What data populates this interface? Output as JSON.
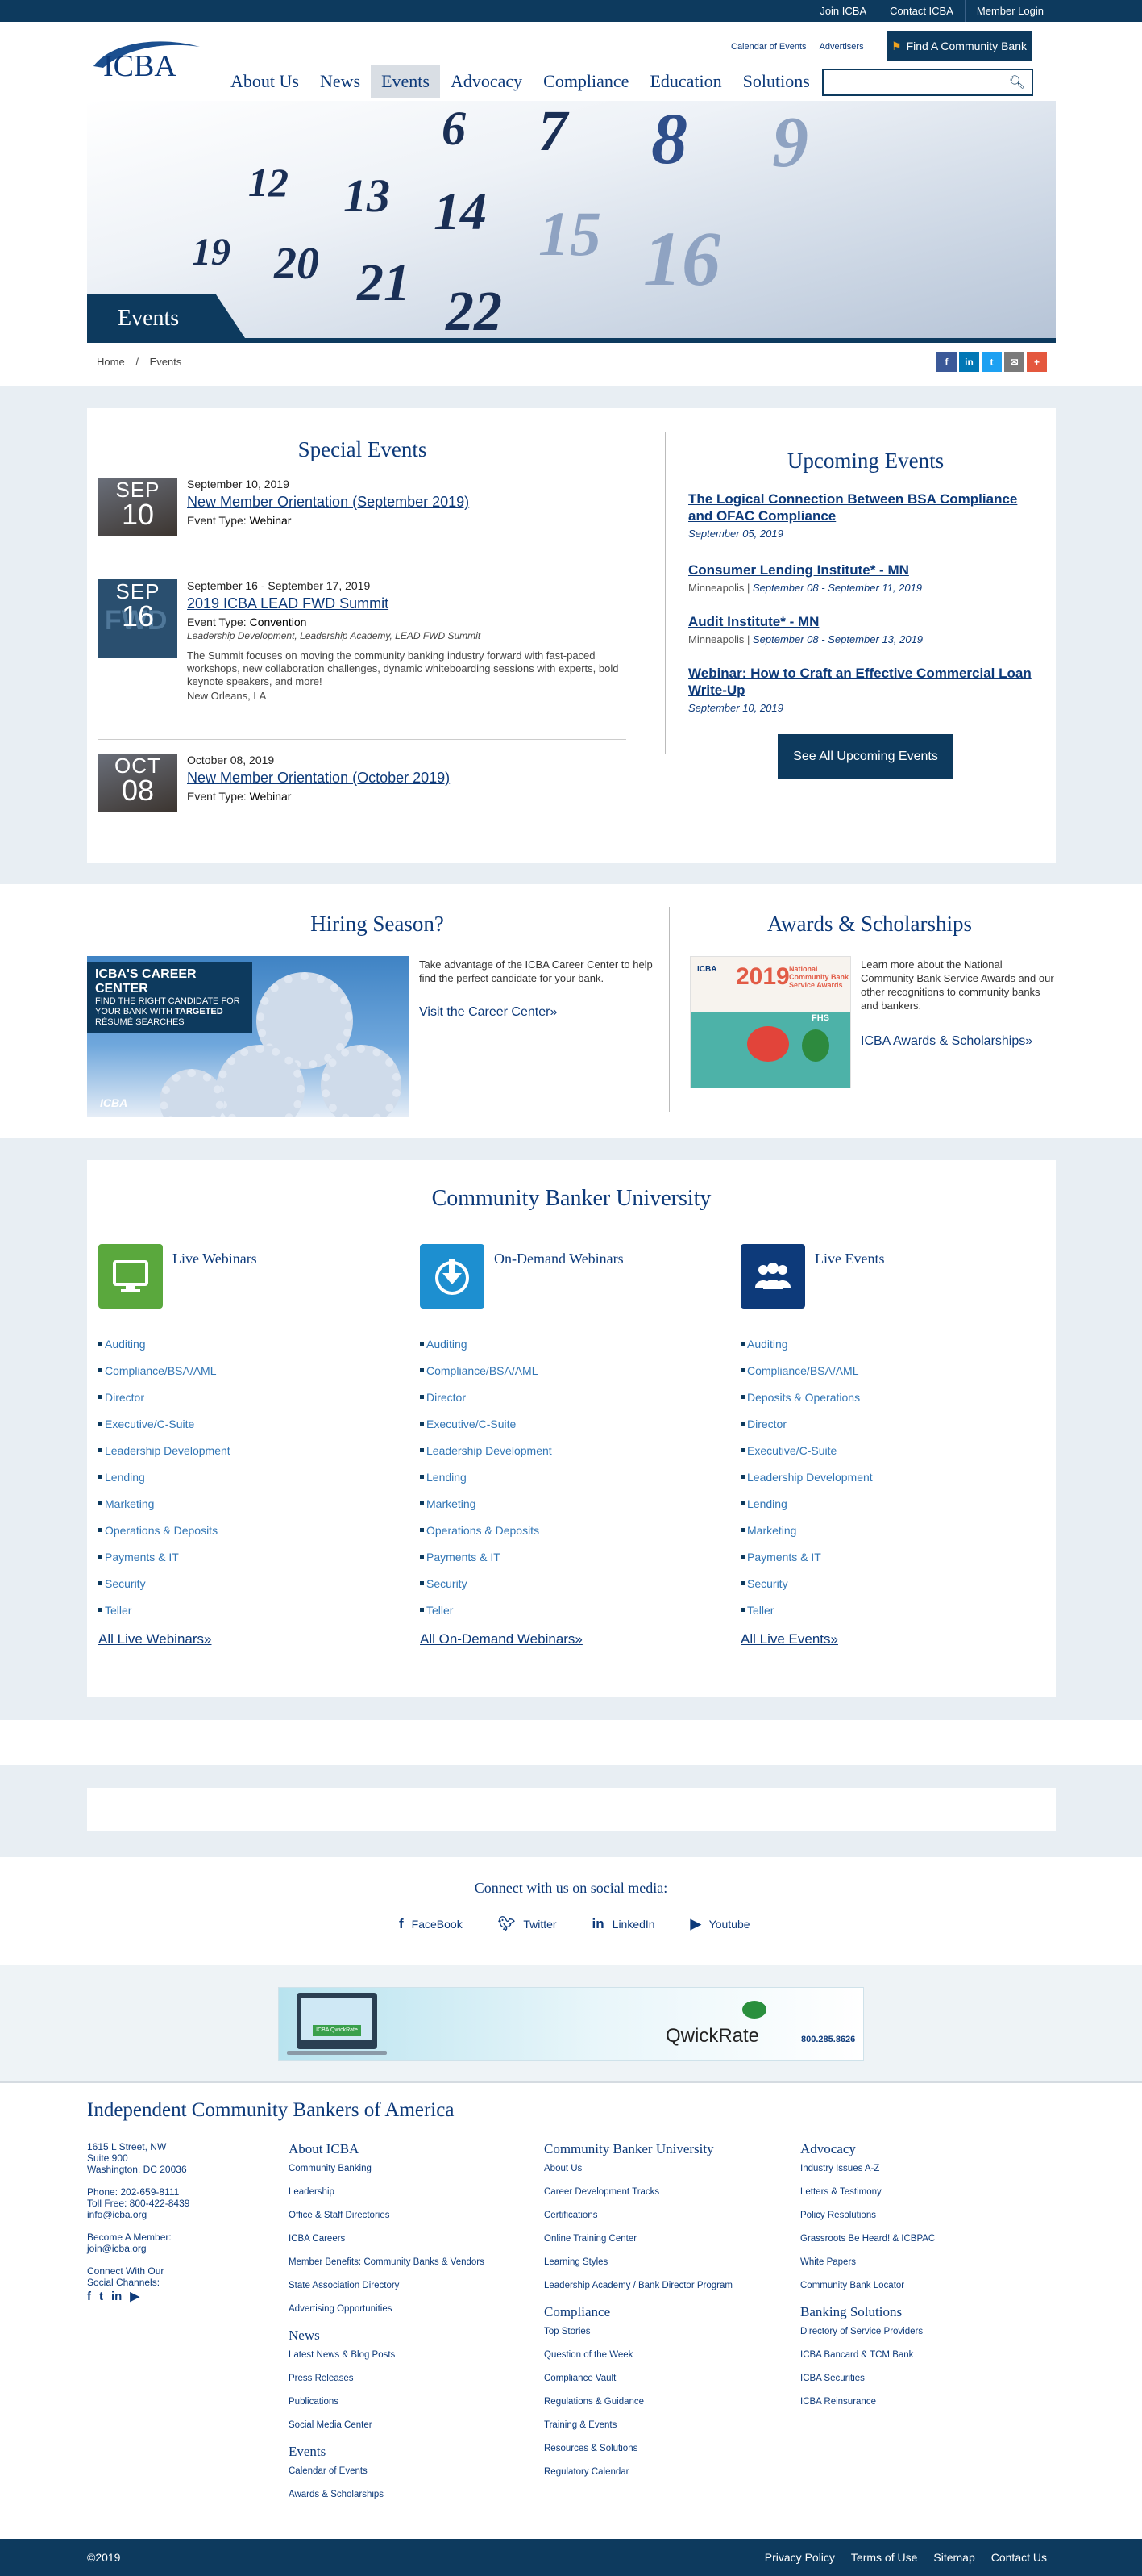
{
  "utility": {
    "links": [
      "Join ICBA",
      "Contact ICBA",
      "Member Login"
    ]
  },
  "header": {
    "logo_text": "ICBA",
    "secondary_links": [
      "Calendar of Events",
      "Advertisers"
    ],
    "find_bank": "Find A Community Bank",
    "search_placeholder": ""
  },
  "nav": {
    "items": [
      "About Us",
      "News",
      "Events",
      "Advocacy",
      "Compliance",
      "Education",
      "Solutions"
    ],
    "active": "Events"
  },
  "hero": {
    "title": "Events",
    "calendar_numbers": [
      "6",
      "7",
      "8",
      "9",
      "12",
      "13",
      "14",
      "15",
      "16",
      "19",
      "20",
      "21",
      "22"
    ]
  },
  "breadcrumb": {
    "home": "Home",
    "separator": "/",
    "current": "Events"
  },
  "share": {
    "facebook": "f",
    "linkedin": "in",
    "twitter": "t",
    "email": "✉",
    "plus": "+"
  },
  "special_events": {
    "heading": "Special Events",
    "items": [
      {
        "thumb_month": "SEP",
        "thumb_day": "10",
        "date": "September 10, 2019",
        "title": "New Member Orientation (September 2019)",
        "type_label": "Event Type:",
        "type": "Webinar"
      },
      {
        "thumb_month": "SEP",
        "thumb_day": "16",
        "thumb_overlay": "FWD",
        "date": "September 16 - September 17, 2019",
        "title": "2019 ICBA LEAD FWD Summit",
        "type_label": "Event Type:",
        "type": "Convention",
        "tags": "Leadership Development, Leadership Academy, LEAD FWD Summit",
        "description": "The Summit focuses on moving the community banking industry forward with fast-paced workshops, new collaboration challenges, dynamic whiteboarding sessions with experts, bold keynote speakers, and more!",
        "location": "New Orleans, LA"
      },
      {
        "thumb_month": "OCT",
        "thumb_day": "08",
        "date": "October 08, 2019",
        "title": "New Member Orientation (October 2019)",
        "type_label": "Event Type:",
        "type": "Webinar"
      }
    ]
  },
  "upcoming_events": {
    "heading": "Upcoming Events",
    "items": [
      {
        "title": "The Logical Connection Between BSA Compliance and OFAC Compliance",
        "location": "",
        "dates": "September 05, 2019"
      },
      {
        "title": "Consumer Lending Institute* - MN",
        "location": "Minneapolis | ",
        "dates": "September 08 - September 11, 2019"
      },
      {
        "title": "Audit Institute* - MN",
        "location": "Minneapolis | ",
        "dates": "September 08 - September 13, 2019"
      },
      {
        "title": "Webinar: How to Craft an Effective Commercial Loan Write-Up",
        "location": "",
        "dates": "September 10, 2019"
      }
    ],
    "see_all": "See All Upcoming Events"
  },
  "hiring": {
    "heading": "Hiring Season?",
    "ad_title": "ICBA'S CAREER CENTER",
    "ad_line1": "FIND THE RIGHT CANDIDATE FOR",
    "ad_line2": "YOUR BANK WITH",
    "ad_line2_bold": "TARGETED",
    "ad_line3": "RÉSUMÉ SEARCHES",
    "ad_logo": "ICBA",
    "text": "Take advantage of the ICBA Career Center to help find the perfect candidate for your bank.",
    "link": "Visit the Career Center»"
  },
  "awards": {
    "heading": "Awards & Scholarships",
    "ad_logo": "ICBA",
    "ad_year": "2019",
    "ad_title": "National Community Bank Service Awards",
    "ad_sponsor": "FHS",
    "text": "Learn more about the National Community Bank Service Awards and our other recognitions to community banks and bankers.",
    "link": "ICBA Awards & Scholarships»"
  },
  "cbu": {
    "heading": "Community Banker University",
    "columns": [
      {
        "title": "Live Webinars",
        "color": "#5aa83d",
        "items": [
          "Auditing",
          "Compliance/BSA/AML",
          "Director",
          "Executive/C-Suite",
          "Leadership Development",
          "Lending",
          "Marketing",
          "Operations & Deposits",
          "Payments & IT",
          "Security",
          "Teller"
        ],
        "all": "All Live Webinars»"
      },
      {
        "title": "On-Demand Webinars",
        "color": "#1d8fd0",
        "items": [
          "Auditing",
          "Compliance/BSA/AML",
          "Director",
          "Executive/C-Suite",
          "Leadership Development",
          "Lending",
          "Marketing",
          "Operations & Deposits",
          "Payments & IT",
          "Security",
          "Teller"
        ],
        "all": "All On-Demand Webinars»"
      },
      {
        "title": "Live Events",
        "color": "#0d3a7a",
        "items": [
          "Auditing",
          "Compliance/BSA/AML",
          "Deposits & Operations",
          "Director",
          "Executive/C-Suite",
          "Leadership Development",
          "Lending",
          "Marketing",
          "Payments & IT",
          "Security",
          "Teller"
        ],
        "all": "All Live Events»"
      }
    ]
  },
  "social": {
    "heading": "Connect with us on social media:",
    "links": [
      "FaceBook",
      "Twitter",
      "LinkedIn",
      "Youtube"
    ]
  },
  "ad": {
    "product": "QwickRate",
    "phone": "800.285.8626",
    "screen_label": "ICBA QwickRate"
  },
  "footer": {
    "title": "Independent Community Bankers of America",
    "address": [
      "1615 L Street, NW",
      "Suite 900",
      "Washington, DC 20036"
    ],
    "phone": "Phone: 202-659-8111",
    "toll_free": "Toll Free: 800-422-8439",
    "email": "info@icba.org",
    "become_member": "Become A Member:",
    "join_email": "join@icba.org",
    "connect": "Connect With Our",
    "connect2": "Social Channels:",
    "columns": [
      {
        "groups": [
          {
            "heading": "About ICBA",
            "links": [
              "Community Banking",
              "Leadership",
              "Office & Staff Directories",
              "ICBA Careers",
              "Member Benefits: Community Banks & Vendors",
              "State Association Directory",
              "Advertising Opportunities"
            ]
          },
          {
            "heading": "News",
            "links": [
              "Latest News & Blog Posts",
              "Press Releases",
              "Publications",
              "Social Media Center"
            ]
          },
          {
            "heading": "Events",
            "links": [
              "Calendar of Events",
              "Awards & Scholarships"
            ]
          }
        ]
      },
      {
        "groups": [
          {
            "heading": "Community Banker University",
            "links": [
              "About Us",
              "Career Development Tracks",
              "Certifications",
              "Online Training Center",
              "Learning Styles",
              "Leadership Academy / Bank Director Program"
            ]
          },
          {
            "heading": "Compliance",
            "links": [
              "Top Stories",
              "Question of the Week",
              "Compliance Vault",
              "Regulations & Guidance",
              "Training & Events",
              "Resources & Solutions",
              "Regulatory Calendar"
            ]
          }
        ]
      },
      {
        "groups": [
          {
            "heading": "Advocacy",
            "links": [
              "Industry Issues A-Z",
              "Letters & Testimony",
              "Policy Resolutions",
              "Grassroots Be Heard! & ICBPAC",
              "White Papers",
              "Community Bank Locator"
            ]
          },
          {
            "heading": "Banking Solutions",
            "links": [
              "Directory of Service Providers",
              "ICBA Bancard & TCM Bank",
              "ICBA Securities",
              "ICBA Reinsurance"
            ]
          }
        ]
      }
    ],
    "copyright": "©2019",
    "bottom_links": [
      "Privacy Policy",
      "Terms of Use",
      "Sitemap",
      "Contact Us"
    ]
  }
}
